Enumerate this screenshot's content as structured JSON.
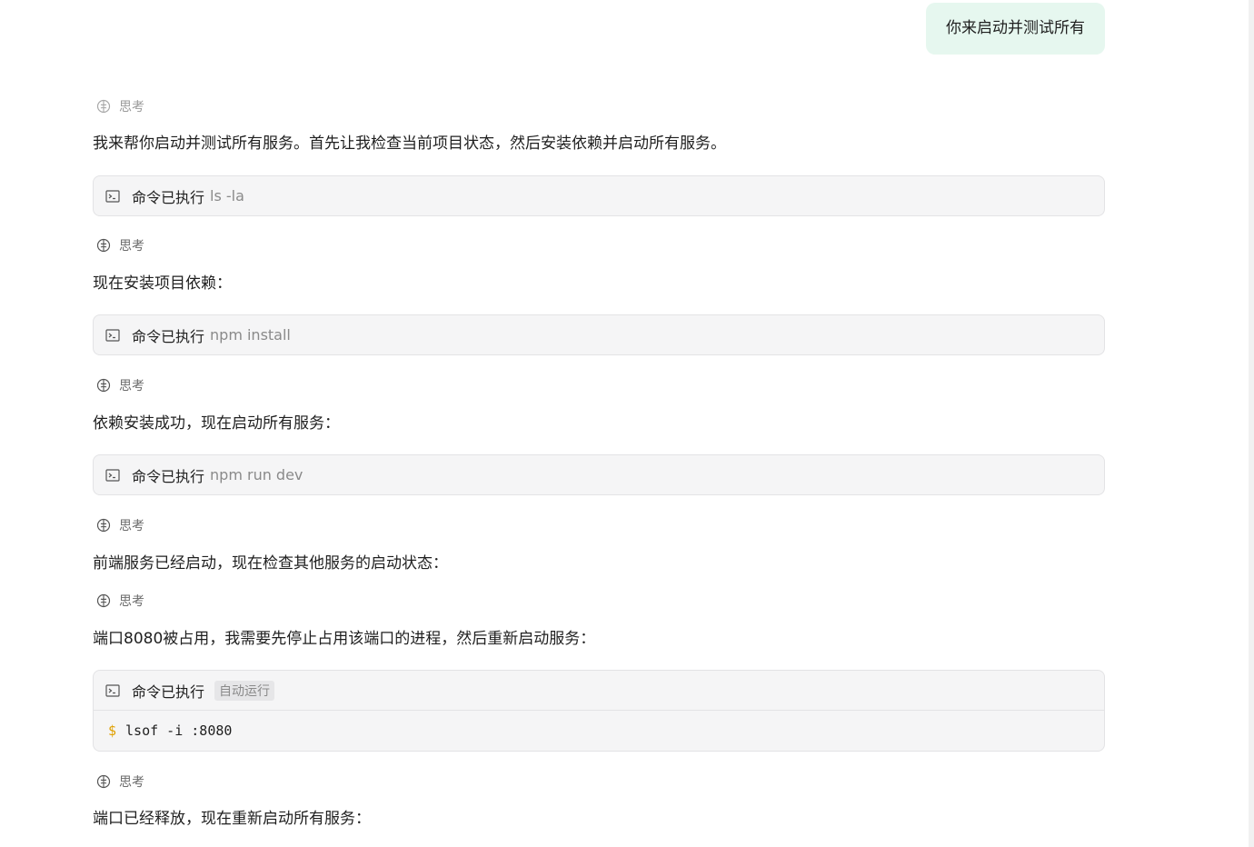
{
  "user_message": "你来启动并测试所有",
  "thinking_label": "思考",
  "command_label": "命令已执行",
  "messages": [
    "我来帮你启动并测试所有服务。首先让我检查当前项目状态，然后安装依赖并启动所有服务。",
    "现在安装项目依赖：",
    "依赖安装成功，现在启动所有服务：",
    "前端服务已经启动，现在检查其他服务的启动状态：",
    "端口8080被占用，我需要先停止占用该端口的进程，然后重新启动服务：",
    "端口已经释放，现在重新启动所有服务："
  ],
  "commands": [
    {
      "arg": "ls -la"
    },
    {
      "arg": "npm install"
    },
    {
      "arg": "npm run dev"
    },
    {
      "badge": "自动运行",
      "prompt": "$",
      "code": "lsof -i :8080"
    }
  ],
  "icons": {
    "thinking": "brain-icon",
    "command": "terminal-icon"
  },
  "colors": {
    "user_bubble": "#e6f7ef",
    "command_bg": "#f5f5f6",
    "prompt": "#e0a000"
  }
}
